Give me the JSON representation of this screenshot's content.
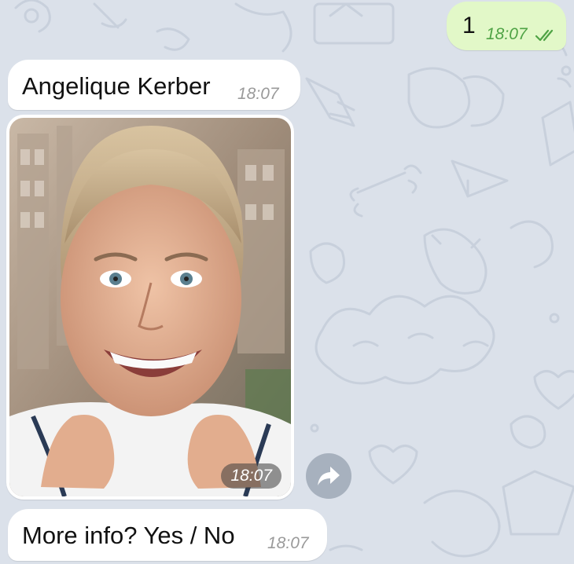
{
  "chat": {
    "background_color": "#dbe1ea",
    "messages": [
      {
        "direction": "outgoing",
        "type": "text",
        "text": "1",
        "time": "18:07",
        "status_icon": "double-check-icon"
      },
      {
        "direction": "incoming",
        "type": "text",
        "text": "Angelique Kerber",
        "time": "18:07"
      },
      {
        "direction": "incoming",
        "type": "photo",
        "time": "18:07",
        "action_icon": "forward-arrow-icon"
      },
      {
        "direction": "incoming",
        "type": "text",
        "text": "More info? Yes / No",
        "time": "18:07"
      }
    ]
  },
  "colors": {
    "outgoing_bubble": "#e2f8c8",
    "incoming_bubble": "#ffffff",
    "outgoing_time": "#4fa345",
    "incoming_time": "#9a9a9a"
  }
}
